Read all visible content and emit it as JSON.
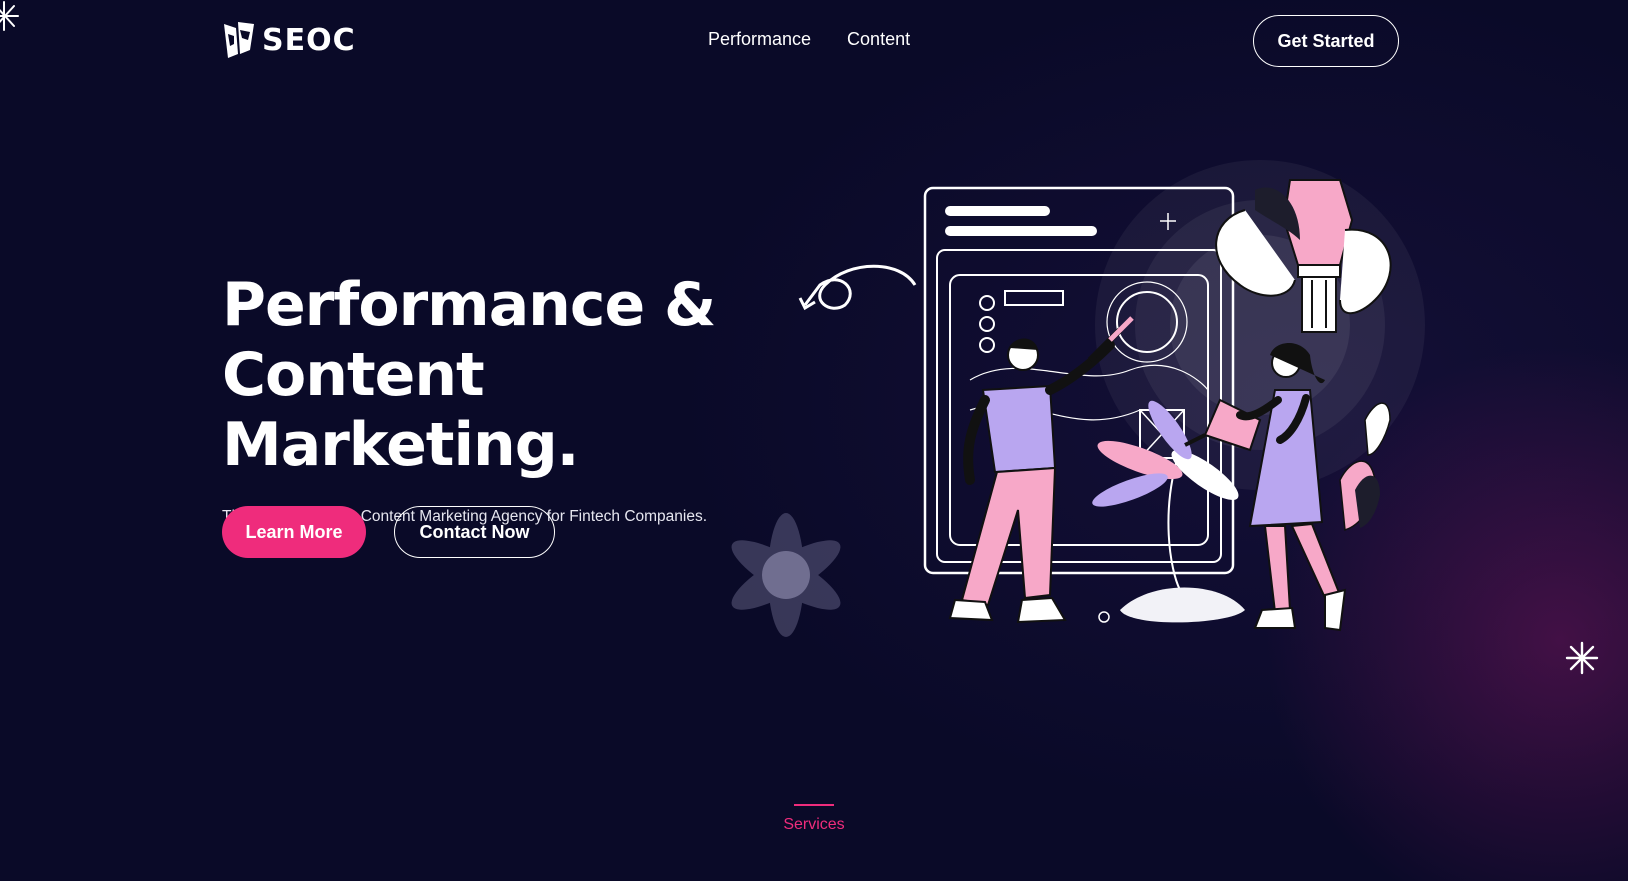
{
  "header": {
    "logo_text": "SEOC",
    "nav": [
      {
        "label": "Performance"
      },
      {
        "label": "Content"
      }
    ],
    "cta_label": "Get Started"
  },
  "hero": {
    "title_line1": "Performance &",
    "title_line2": "Content Marketing.",
    "subtitle": "The Performance & Content Marketing Agency for Fintech Companies.",
    "primary_button": "Learn More",
    "secondary_button": "Contact Now"
  },
  "section": {
    "label": "Services"
  },
  "colors": {
    "background": "#0a0a28",
    "accent": "#ef2c7c",
    "pink": "#f7a8c8",
    "lavender": "#b9a6f0"
  }
}
